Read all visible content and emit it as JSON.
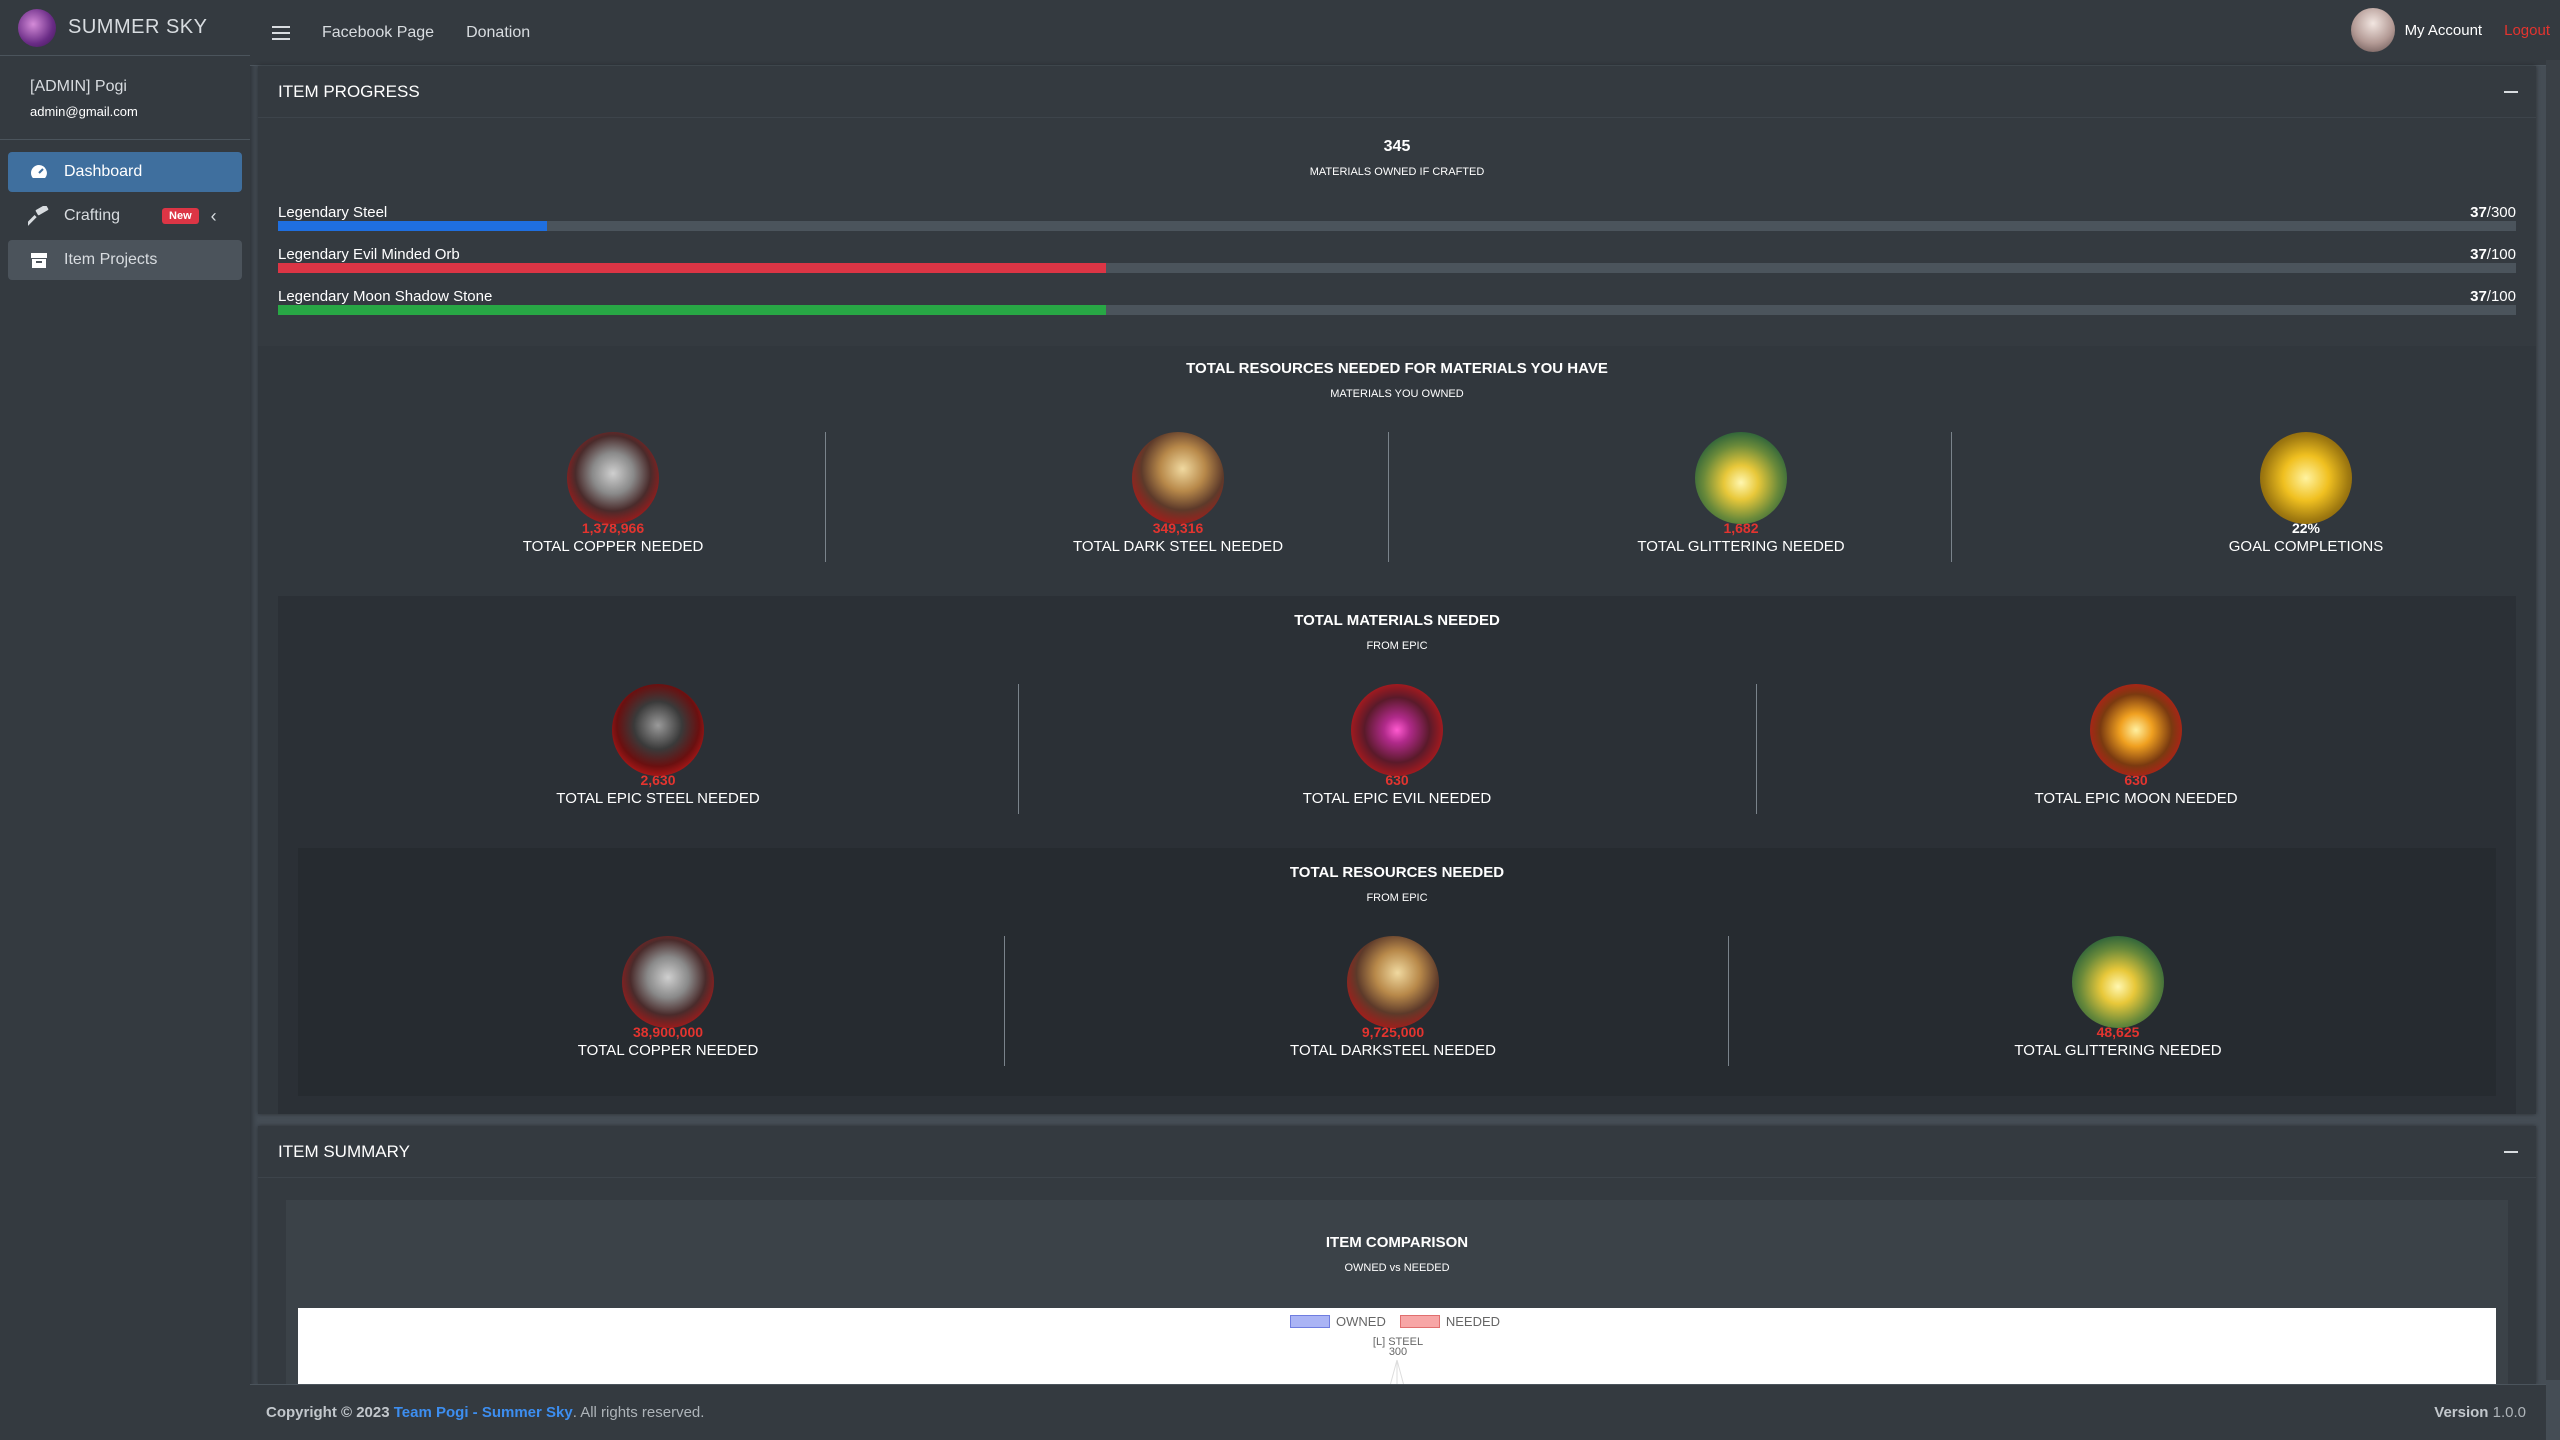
{
  "brand": {
    "name": "SUMMER SKY"
  },
  "user": {
    "name": "[ADMIN] Pogi",
    "email": "admin@gmail.com"
  },
  "nav": {
    "dashboard": "Dashboard",
    "crafting": "Crafting",
    "crafting_badge": "New",
    "item_projects": "Item Projects"
  },
  "header": {
    "facebook": "Facebook Page",
    "donation": "Donation",
    "my_account": "My Account",
    "logout": "Logout"
  },
  "progress": {
    "title": "ITEM PROGRESS",
    "materials_owned": "345",
    "materials_owned_label": "MATERIALS OWNED IF CRAFTED",
    "items": [
      {
        "label": "Legendary Steel",
        "owned": "37",
        "total": "/300",
        "percent": 12,
        "color": "#1f6fe0"
      },
      {
        "label": "Legendary Evil Minded Orb",
        "owned": "37",
        "total": "/100",
        "percent": 37,
        "color": "#dc3545"
      },
      {
        "label": "Legendary Moon Shadow Stone",
        "owned": "37",
        "total": "/100",
        "percent": 37,
        "color": "#28a745"
      }
    ]
  },
  "owned_resources": {
    "title": "TOTAL RESOURCES NEEDED FOR MATERIALS YOU HAVE",
    "subtitle": "MATERIALS YOU OWNED",
    "stats": [
      {
        "value": "1,378,966",
        "label": "TOTAL COPPER NEEDED",
        "icon": "copper-icon"
      },
      {
        "value": "349,316",
        "label": "TOTAL DARK STEEL NEEDED",
        "icon": "dark-steel-chest-icon"
      },
      {
        "value": "1,682",
        "label": "TOTAL GLITTERING NEEDED",
        "icon": "glittering-icon"
      },
      {
        "value": "22%",
        "label": "GOAL COMPLETIONS",
        "icon": "goal-icon"
      }
    ]
  },
  "materials": {
    "title": "TOTAL MATERIALS NEEDED",
    "subtitle": "FROM EPIC",
    "stats": [
      {
        "value": "2,630",
        "label": "TOTAL EPIC STEEL NEEDED",
        "icon": "epic-steel-icon"
      },
      {
        "value": "630",
        "label": "TOTAL EPIC EVIL NEEDED",
        "icon": "epic-evil-icon"
      },
      {
        "value": "630",
        "label": "TOTAL EPIC MOON NEEDED",
        "icon": "epic-moon-icon"
      }
    ]
  },
  "resources": {
    "title": "TOTAL RESOURCES NEEDED",
    "subtitle": "FROM EPIC",
    "stats": [
      {
        "value": "38,900,000",
        "label": "TOTAL COPPER NEEDED",
        "icon": "copper-icon"
      },
      {
        "value": "9,725,000",
        "label": "TOTAL DARKSTEEL NEEDED",
        "icon": "dark-steel-chest-icon"
      },
      {
        "value": "48,625",
        "label": "TOTAL GLITTERING NEEDED",
        "icon": "glittering-icon"
      }
    ]
  },
  "summary": {
    "title": "ITEM SUMMARY",
    "chart_title": "ITEM COMPARISON",
    "chart_subtitle": "OWNED vs NEEDED",
    "legend_owned": "OWNED",
    "legend_needed": "NEEDED",
    "axis_label": "[L] STEEL",
    "axis_value": "300"
  },
  "chart_data": {
    "type": "radar",
    "title": "ITEM COMPARISON",
    "subtitle": "OWNED vs NEEDED",
    "categories": [
      "[L] STEEL"
    ],
    "series": [
      {
        "name": "OWNED",
        "values": []
      },
      {
        "name": "NEEDED",
        "values": []
      }
    ],
    "tick_labels": [
      "300"
    ]
  },
  "footer": {
    "copyright": "Copyright © 2023 ",
    "team": "Team Pogi - Summer Sky",
    "rights": ". All rights reserved.",
    "version_label": "Version",
    "version": " 1.0.0"
  }
}
